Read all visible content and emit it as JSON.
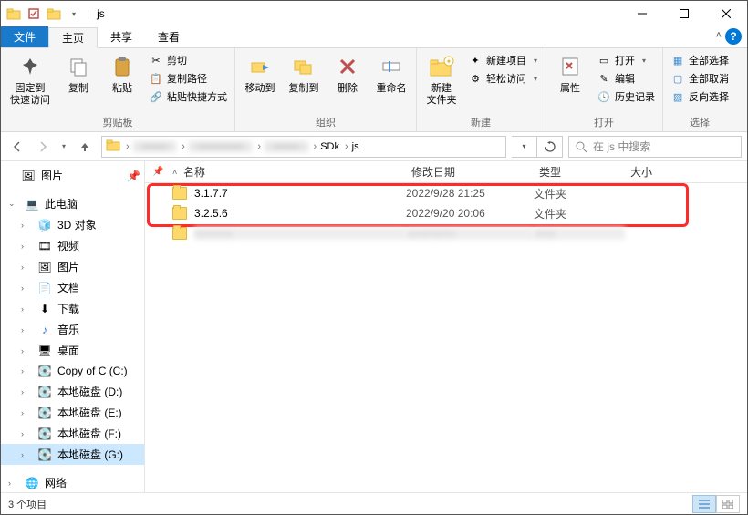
{
  "title": "js",
  "tabs": {
    "file": "文件",
    "home": "主页",
    "share": "共享",
    "view": "查看"
  },
  "ribbon": {
    "clipboard": {
      "label": "剪贴板",
      "pin": "固定到\n快速访问",
      "copy": "复制",
      "paste": "粘贴",
      "cut": "剪切",
      "copy_path": "复制路径",
      "paste_shortcut": "粘贴快捷方式"
    },
    "organize": {
      "label": "组织",
      "move_to": "移动到",
      "copy_to": "复制到",
      "delete": "删除",
      "rename": "重命名"
    },
    "new_group": {
      "label": "新建",
      "new_folder": "新建\n文件夹",
      "new_item": "新建项目",
      "easy_access": "轻松访问"
    },
    "open_group": {
      "label": "打开",
      "properties": "属性",
      "open": "打开",
      "edit": "编辑",
      "history": "历史记录"
    },
    "select_group": {
      "label": "选择",
      "select_all": "全部选择",
      "select_none": "全部取消",
      "invert": "反向选择"
    }
  },
  "breadcrumbs": {
    "sdk": "SDk",
    "js": "js"
  },
  "search": {
    "placeholder": "在 js 中搜索"
  },
  "columns": {
    "name": "名称",
    "date": "修改日期",
    "type": "类型",
    "size": "大小"
  },
  "files": [
    {
      "name": "3.1.7.7",
      "date": "2022/9/28 21:25",
      "type": "文件夹",
      "size": ""
    },
    {
      "name": "3.2.5.6",
      "date": "2022/9/20 20:06",
      "type": "文件夹",
      "size": ""
    }
  ],
  "sidebar": {
    "pictures_q": "图片",
    "this_pc": "此电脑",
    "children": {
      "3d": "3D 对象",
      "videos": "视频",
      "pictures": "图片",
      "documents": "文档",
      "downloads": "下载",
      "music": "音乐",
      "desktop": "桌面",
      "c": "Copy of C (C:)",
      "d": "本地磁盘 (D:)",
      "e": "本地磁盘 (E:)",
      "f": "本地磁盘 (F:)",
      "g": "本地磁盘 (G:)"
    },
    "network": "网络"
  },
  "status": {
    "count": "3 个项目"
  }
}
